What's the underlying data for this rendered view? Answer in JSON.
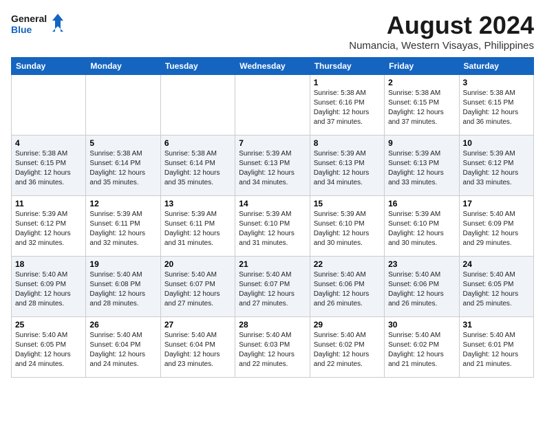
{
  "logo": {
    "line1": "General",
    "line2": "Blue"
  },
  "title": "August 2024",
  "subtitle": "Numancia, Western Visayas, Philippines",
  "weekdays": [
    "Sunday",
    "Monday",
    "Tuesday",
    "Wednesday",
    "Thursday",
    "Friday",
    "Saturday"
  ],
  "weeks": [
    [
      {
        "day": "",
        "info": ""
      },
      {
        "day": "",
        "info": ""
      },
      {
        "day": "",
        "info": ""
      },
      {
        "day": "",
        "info": ""
      },
      {
        "day": "1",
        "info": "Sunrise: 5:38 AM\nSunset: 6:16 PM\nDaylight: 12 hours\nand 37 minutes."
      },
      {
        "day": "2",
        "info": "Sunrise: 5:38 AM\nSunset: 6:15 PM\nDaylight: 12 hours\nand 37 minutes."
      },
      {
        "day": "3",
        "info": "Sunrise: 5:38 AM\nSunset: 6:15 PM\nDaylight: 12 hours\nand 36 minutes."
      }
    ],
    [
      {
        "day": "4",
        "info": "Sunrise: 5:38 AM\nSunset: 6:15 PM\nDaylight: 12 hours\nand 36 minutes."
      },
      {
        "day": "5",
        "info": "Sunrise: 5:38 AM\nSunset: 6:14 PM\nDaylight: 12 hours\nand 35 minutes."
      },
      {
        "day": "6",
        "info": "Sunrise: 5:38 AM\nSunset: 6:14 PM\nDaylight: 12 hours\nand 35 minutes."
      },
      {
        "day": "7",
        "info": "Sunrise: 5:39 AM\nSunset: 6:13 PM\nDaylight: 12 hours\nand 34 minutes."
      },
      {
        "day": "8",
        "info": "Sunrise: 5:39 AM\nSunset: 6:13 PM\nDaylight: 12 hours\nand 34 minutes."
      },
      {
        "day": "9",
        "info": "Sunrise: 5:39 AM\nSunset: 6:13 PM\nDaylight: 12 hours\nand 33 minutes."
      },
      {
        "day": "10",
        "info": "Sunrise: 5:39 AM\nSunset: 6:12 PM\nDaylight: 12 hours\nand 33 minutes."
      }
    ],
    [
      {
        "day": "11",
        "info": "Sunrise: 5:39 AM\nSunset: 6:12 PM\nDaylight: 12 hours\nand 32 minutes."
      },
      {
        "day": "12",
        "info": "Sunrise: 5:39 AM\nSunset: 6:11 PM\nDaylight: 12 hours\nand 32 minutes."
      },
      {
        "day": "13",
        "info": "Sunrise: 5:39 AM\nSunset: 6:11 PM\nDaylight: 12 hours\nand 31 minutes."
      },
      {
        "day": "14",
        "info": "Sunrise: 5:39 AM\nSunset: 6:10 PM\nDaylight: 12 hours\nand 31 minutes."
      },
      {
        "day": "15",
        "info": "Sunrise: 5:39 AM\nSunset: 6:10 PM\nDaylight: 12 hours\nand 30 minutes."
      },
      {
        "day": "16",
        "info": "Sunrise: 5:39 AM\nSunset: 6:10 PM\nDaylight: 12 hours\nand 30 minutes."
      },
      {
        "day": "17",
        "info": "Sunrise: 5:40 AM\nSunset: 6:09 PM\nDaylight: 12 hours\nand 29 minutes."
      }
    ],
    [
      {
        "day": "18",
        "info": "Sunrise: 5:40 AM\nSunset: 6:09 PM\nDaylight: 12 hours\nand 28 minutes."
      },
      {
        "day": "19",
        "info": "Sunrise: 5:40 AM\nSunset: 6:08 PM\nDaylight: 12 hours\nand 28 minutes."
      },
      {
        "day": "20",
        "info": "Sunrise: 5:40 AM\nSunset: 6:07 PM\nDaylight: 12 hours\nand 27 minutes."
      },
      {
        "day": "21",
        "info": "Sunrise: 5:40 AM\nSunset: 6:07 PM\nDaylight: 12 hours\nand 27 minutes."
      },
      {
        "day": "22",
        "info": "Sunrise: 5:40 AM\nSunset: 6:06 PM\nDaylight: 12 hours\nand 26 minutes."
      },
      {
        "day": "23",
        "info": "Sunrise: 5:40 AM\nSunset: 6:06 PM\nDaylight: 12 hours\nand 26 minutes."
      },
      {
        "day": "24",
        "info": "Sunrise: 5:40 AM\nSunset: 6:05 PM\nDaylight: 12 hours\nand 25 minutes."
      }
    ],
    [
      {
        "day": "25",
        "info": "Sunrise: 5:40 AM\nSunset: 6:05 PM\nDaylight: 12 hours\nand 24 minutes."
      },
      {
        "day": "26",
        "info": "Sunrise: 5:40 AM\nSunset: 6:04 PM\nDaylight: 12 hours\nand 24 minutes."
      },
      {
        "day": "27",
        "info": "Sunrise: 5:40 AM\nSunset: 6:04 PM\nDaylight: 12 hours\nand 23 minutes."
      },
      {
        "day": "28",
        "info": "Sunrise: 5:40 AM\nSunset: 6:03 PM\nDaylight: 12 hours\nand 22 minutes."
      },
      {
        "day": "29",
        "info": "Sunrise: 5:40 AM\nSunset: 6:02 PM\nDaylight: 12 hours\nand 22 minutes."
      },
      {
        "day": "30",
        "info": "Sunrise: 5:40 AM\nSunset: 6:02 PM\nDaylight: 12 hours\nand 21 minutes."
      },
      {
        "day": "31",
        "info": "Sunrise: 5:40 AM\nSunset: 6:01 PM\nDaylight: 12 hours\nand 21 minutes."
      }
    ]
  ]
}
